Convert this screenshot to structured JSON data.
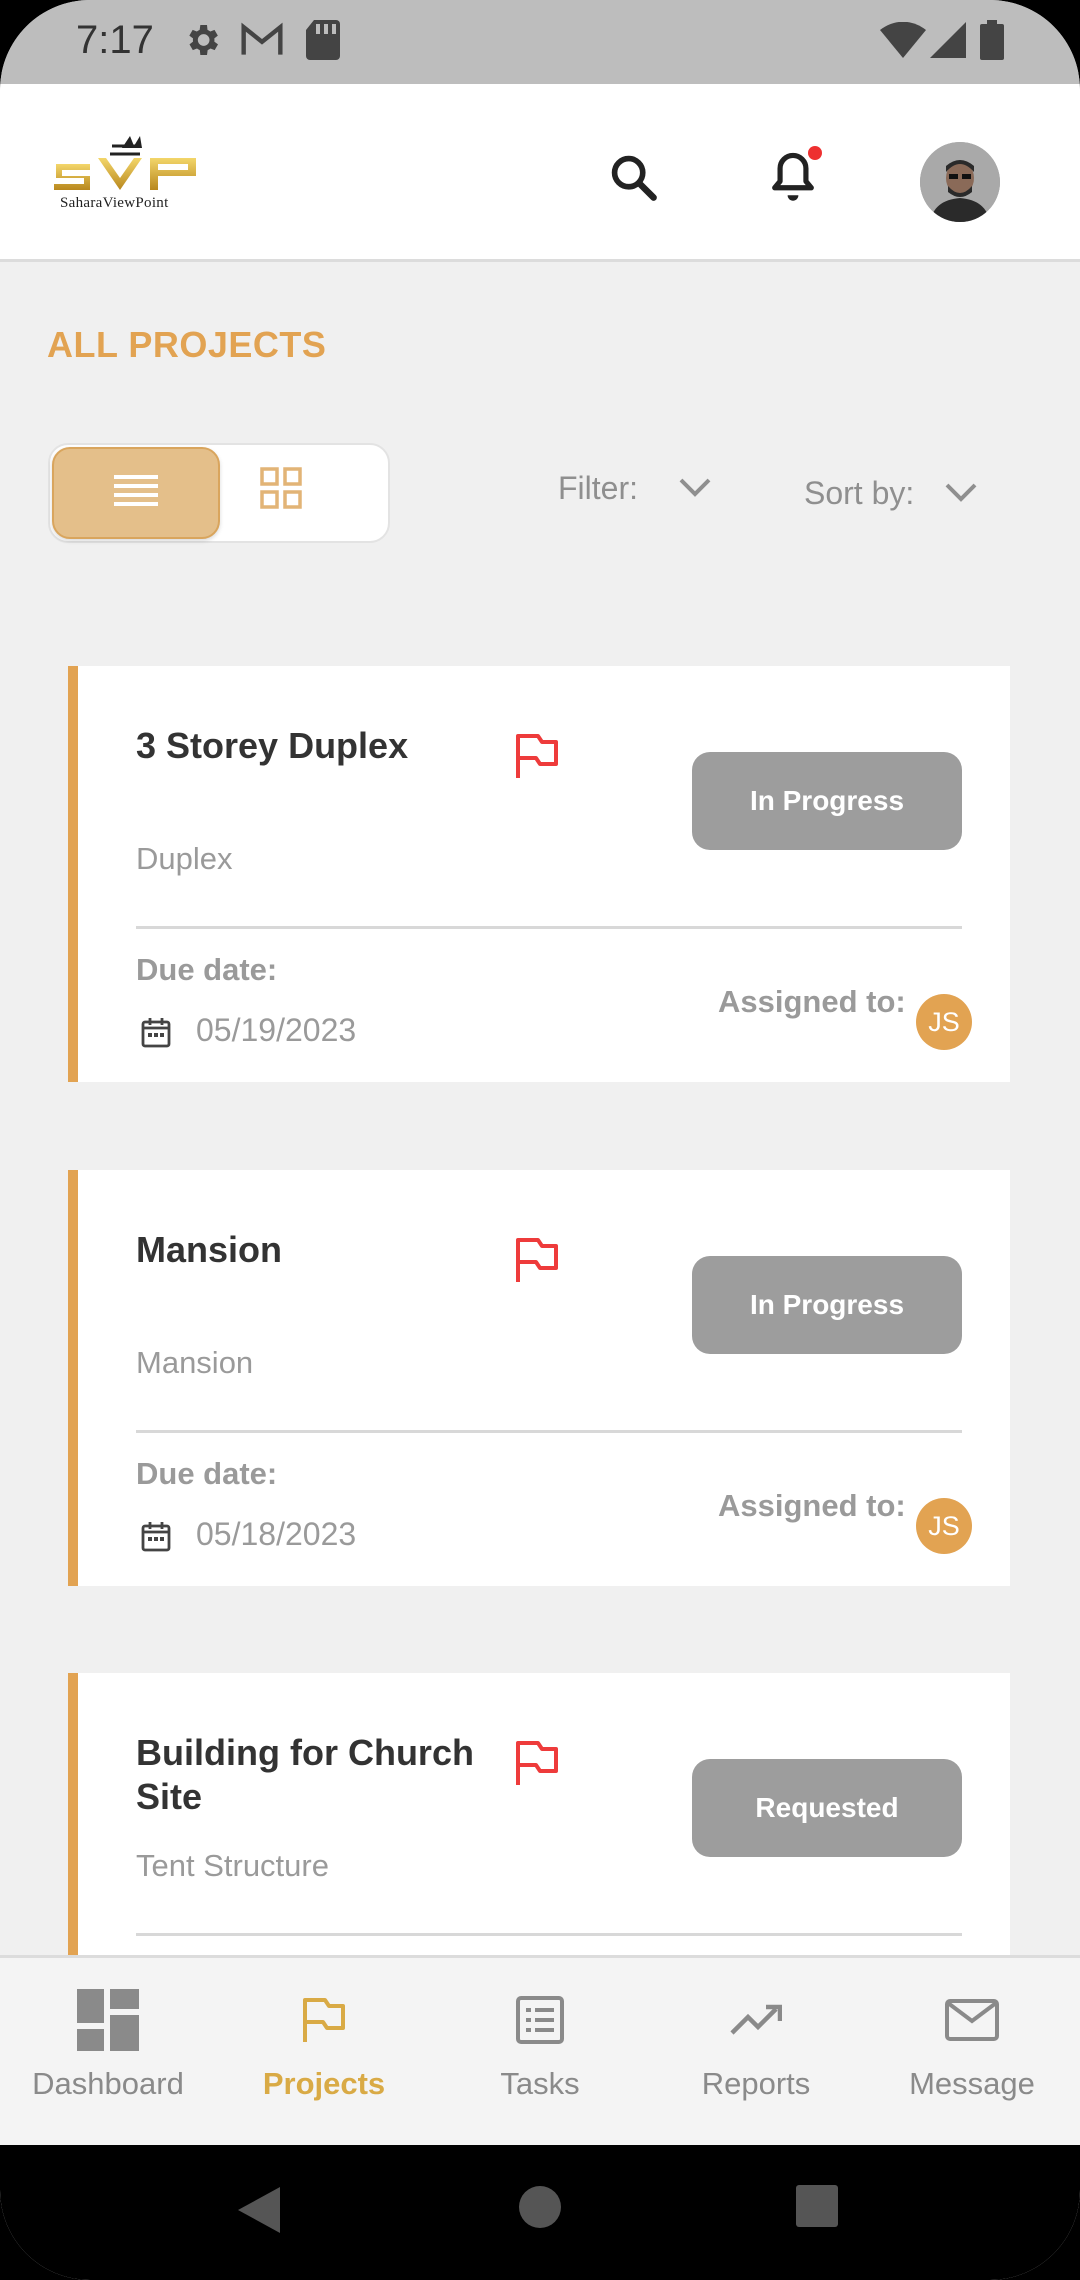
{
  "status_bar": {
    "time": "7:17",
    "icons": [
      "gear-icon",
      "gmail-icon",
      "sd-card-icon",
      "wifi-icon",
      "signal-icon",
      "battery-icon"
    ]
  },
  "header": {
    "logo_text": "SaharaViewPoint",
    "icons": [
      "search-icon",
      "bell-icon"
    ],
    "avatar": "avatar"
  },
  "page": {
    "title": "ALL PROJECTS"
  },
  "view_toggle": {
    "selected": "list",
    "options": [
      "list",
      "grid"
    ]
  },
  "filter": {
    "label": "Filter:"
  },
  "sort": {
    "label": "Sort by:"
  },
  "projects": [
    {
      "title": "3 Storey Duplex",
      "type": "Duplex",
      "status": "In Progress",
      "due_label": "Due date:",
      "due_date": "05/19/2023",
      "assigned_label": "Assigned to:",
      "assignee": "JS"
    },
    {
      "title": "Mansion",
      "type": "Mansion",
      "status": "In Progress",
      "due_label": "Due date:",
      "due_date": "05/18/2023",
      "assigned_label": "Assigned to:",
      "assignee": "JS"
    },
    {
      "title": "Building for Church Site",
      "type": "Tent Structure",
      "status": "Requested"
    }
  ],
  "bottom_nav": [
    {
      "label": "Dashboard",
      "icon": "dashboard-icon"
    },
    {
      "label": "Projects",
      "icon": "flag-icon",
      "active": true
    },
    {
      "label": "Tasks",
      "icon": "tasks-icon"
    },
    {
      "label": "Reports",
      "icon": "trending-icon"
    },
    {
      "label": "Message",
      "icon": "mail-icon"
    }
  ],
  "colors": {
    "accent": "#e2a352",
    "status_badge": "#9d9d9d",
    "flag": "#ee3b3b",
    "status_bar": "#bdbdbd"
  }
}
